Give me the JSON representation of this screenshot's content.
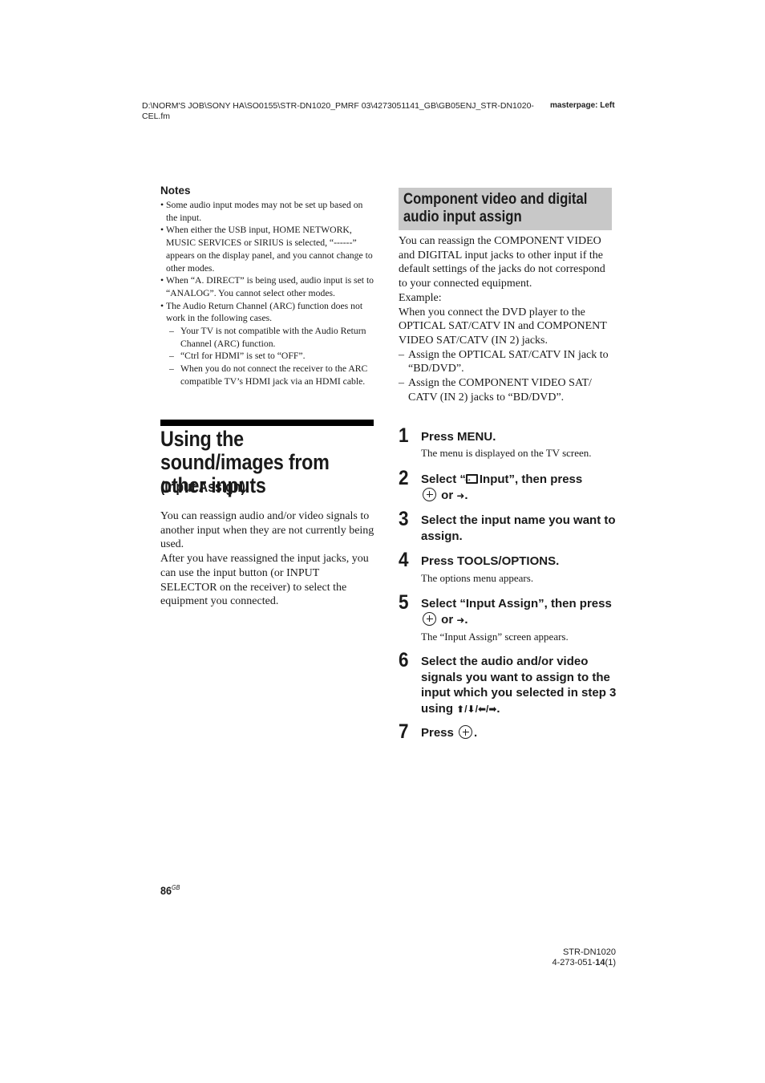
{
  "header": {
    "path": "D:\\NORM'S JOB\\SONY HA\\SO0155\\STR-DN1020_PMRF 03\\4273051141_GB\\GB05ENJ_STR-DN1020-CEL.fm",
    "masterpage": "masterpage: Left"
  },
  "notes": {
    "title": "Notes",
    "items": [
      "Some audio input modes may not be set up based on the input.",
      "When either the USB input, HOME NETWORK, MUSIC SERVICES or SIRIUS is selected, “------” appears on the display panel, and you cannot change to other modes.",
      "When “A. DIRECT” is being used, audio input is set to “ANALOG”. You cannot select other modes.",
      "The Audio Return Channel (ARC) function does not work in the following cases."
    ],
    "sub_items": [
      "Your TV is not compatible with the Audio Return Channel (ARC) function.",
      "“Ctrl for HDMI” is set to “OFF”.",
      "When you do not connect the receiver to the ARC compatible TV’s HDMI jack via an HDMI cable."
    ]
  },
  "main_section": {
    "title": "Using the sound/images from other inputs",
    "subtitle": "(Input Assign)",
    "intro_1": "You can reassign audio and/or video signals to another input when they are not currently being used.",
    "intro_2": "After you have reassigned the input jacks, you can use the input button (or INPUT SELECTOR on the receiver) to select the equipment you connected."
  },
  "component_section": {
    "title": "Component video and digital audio input assign",
    "body": "You can reassign the COMPONENT VIDEO and DIGITAL input jacks to other input if the default settings of the jacks do not correspond to your connected equipment.",
    "example_label": "Example:",
    "example_text": "When you connect the DVD player to the OPTICAL SAT/CATV IN and COMPONENT VIDEO SAT/CATV (IN 2) jacks.",
    "example_items": [
      "Assign the OPTICAL SAT/CATV IN jack to “BD/DVD”.",
      "Assign the COMPONENT VIDEO SAT/ CATV (IN 2) jacks to “BD/DVD”."
    ]
  },
  "steps": [
    {
      "num": "1",
      "text": "Press MENU.",
      "sub": "The menu is displayed on the TV screen."
    },
    {
      "num": "2",
      "text_a": "Select “",
      "text_b": "Input”, then press",
      "text_c": "or",
      "arrow": "➜",
      "end": "."
    },
    {
      "num": "3",
      "text": "Select the input name you want to assign."
    },
    {
      "num": "4",
      "text": "Press TOOLS/OPTIONS.",
      "sub": "The options menu appears."
    },
    {
      "num": "5",
      "text_a": "Select “Input Assign”, then press",
      "text_c": "or",
      "arrow": "➜",
      "end": ".",
      "sub": "The “Input Assign” screen appears."
    },
    {
      "num": "6",
      "text": "Select the audio and/or video signals you want to assign to the input which you selected in step 3 using",
      "arrows": "⬆/⬇/⬅/➡",
      "end": "."
    },
    {
      "num": "7",
      "text": "Press",
      "end": "."
    }
  ],
  "page": {
    "number": "86",
    "suffix": "GB"
  },
  "footer": {
    "model": "STR-DN1020",
    "code_a": "4-273-051-",
    "code_b": "14",
    "code_c": "(1)"
  }
}
